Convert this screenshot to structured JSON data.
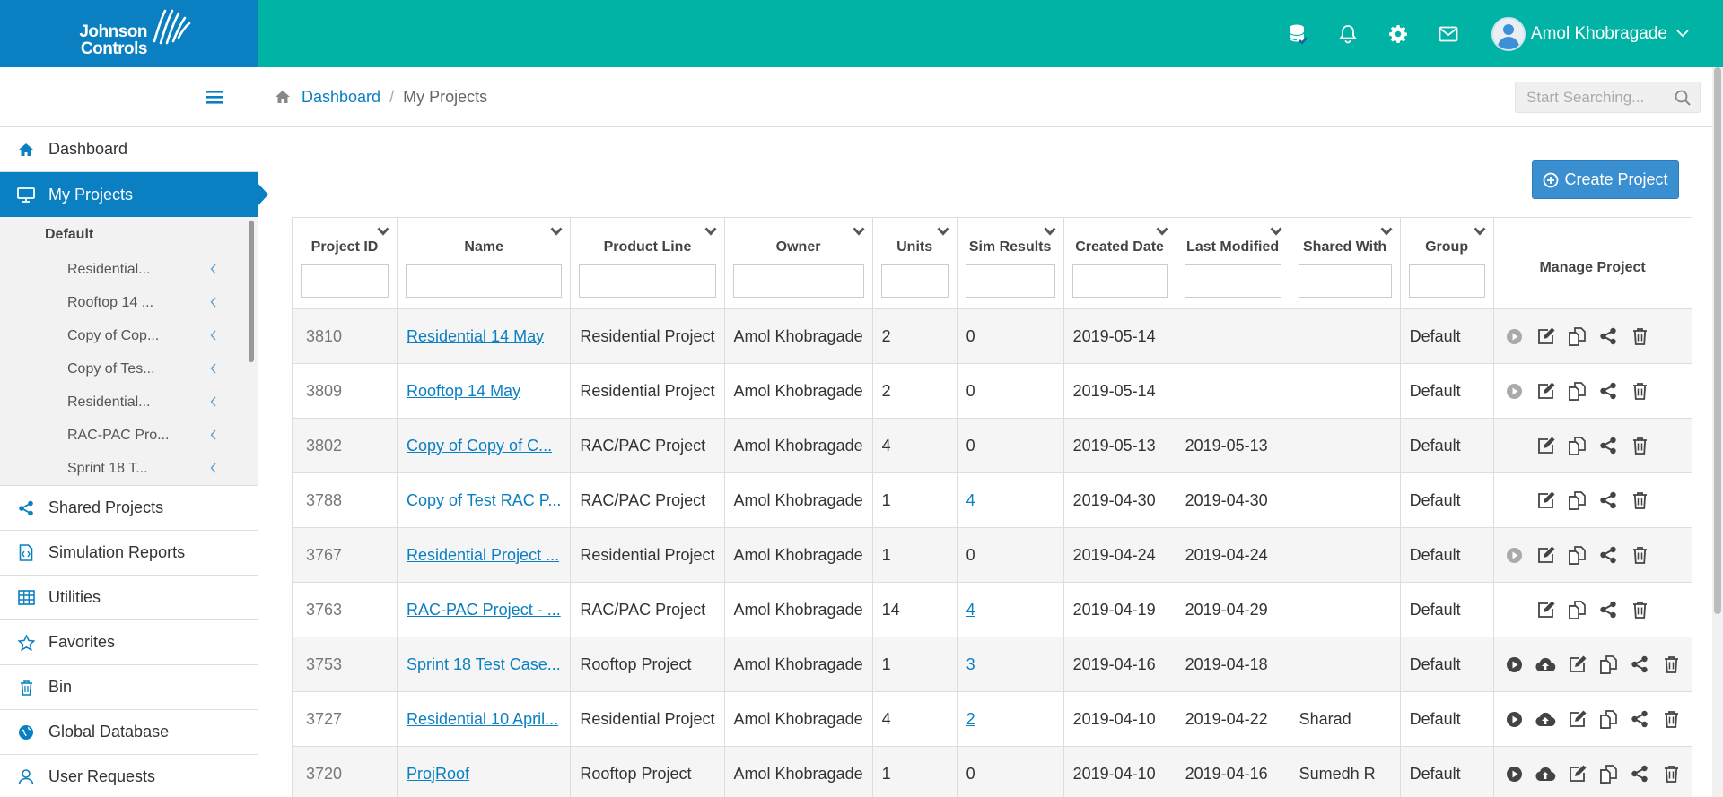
{
  "brand": {
    "line1": "Johnson",
    "line2": "Controls"
  },
  "header": {
    "icons": [
      "database-icon",
      "bell-icon",
      "gear-icon",
      "mail-icon"
    ],
    "user_name": "Amol Khobragade"
  },
  "sidebar": {
    "items": [
      {
        "label": "Dashboard",
        "icon": "home-icon"
      },
      {
        "label": "My Projects",
        "icon": "monitor-icon",
        "active": true
      }
    ],
    "group_label": "Default",
    "sub_items": [
      "Residential...",
      "Rooftop 14 ...",
      "Copy of Cop...",
      "Copy of Tes...",
      "Residential...",
      "RAC-PAC Pro...",
      "Sprint 18 T..."
    ],
    "bottom_items": [
      {
        "label": "Shared Projects",
        "icon": "share-icon"
      },
      {
        "label": "Simulation Reports",
        "icon": "report-icon"
      },
      {
        "label": "Utilities",
        "icon": "grid-icon"
      },
      {
        "label": "Favorites",
        "icon": "star-icon"
      },
      {
        "label": "Bin",
        "icon": "trash-icon"
      },
      {
        "label": "Global Database",
        "icon": "globe-icon"
      },
      {
        "label": "User Requests",
        "icon": "user-icon"
      }
    ]
  },
  "breadcrumb": {
    "home": "Dashboard",
    "sep": "/",
    "current": "My Projects"
  },
  "search": {
    "placeholder": "Start Searching..."
  },
  "create_button": "Create Project",
  "table": {
    "columns": [
      "Project ID",
      "Name",
      "Product Line",
      "Owner",
      "Units",
      "Sim Results",
      "Created Date",
      "Last Modified",
      "Shared With",
      "Group",
      "Manage Project"
    ],
    "rows": [
      {
        "id": "3810",
        "name": "Residential 14 May",
        "product": "Residential Project",
        "owner": "Amol Khobragade",
        "units": "2",
        "sim": "0",
        "sim_link": false,
        "created": "2019-05-14",
        "modified": "",
        "shared": "",
        "group": "Default",
        "actions": [
          "play-muted",
          "edit",
          "copy",
          "share",
          "delete"
        ]
      },
      {
        "id": "3809",
        "name": "Rooftop 14 May",
        "product": "Residential Project",
        "owner": "Amol Khobragade",
        "units": "2",
        "sim": "0",
        "sim_link": false,
        "created": "2019-05-14",
        "modified": "",
        "shared": "",
        "group": "Default",
        "actions": [
          "play-muted",
          "edit",
          "copy",
          "share",
          "delete"
        ]
      },
      {
        "id": "3802",
        "name": "Copy of Copy of C...",
        "product": "RAC/PAC Project",
        "owner": "Amol Khobragade",
        "units": "4",
        "sim": "0",
        "sim_link": false,
        "created": "2019-05-13",
        "modified": "2019-05-13",
        "shared": "",
        "group": "Default",
        "actions": [
          "blank",
          "edit",
          "copy",
          "share",
          "delete"
        ]
      },
      {
        "id": "3788",
        "name": "Copy of Test RAC P...",
        "product": "RAC/PAC Project",
        "owner": "Amol Khobragade",
        "units": "1",
        "sim": "4",
        "sim_link": true,
        "created": "2019-04-30",
        "modified": "2019-04-30",
        "shared": "",
        "group": "Default",
        "actions": [
          "blank",
          "edit",
          "copy",
          "share",
          "delete"
        ]
      },
      {
        "id": "3767",
        "name": "Residential Project ...",
        "product": "Residential Project",
        "owner": "Amol Khobragade",
        "units": "1",
        "sim": "0",
        "sim_link": false,
        "created": "2019-04-24",
        "modified": "2019-04-24",
        "shared": "",
        "group": "Default",
        "actions": [
          "play-muted",
          "edit",
          "copy",
          "share",
          "delete"
        ]
      },
      {
        "id": "3763",
        "name": "RAC-PAC Project - ...",
        "product": "RAC/PAC Project",
        "owner": "Amol Khobragade",
        "units": "14",
        "sim": "4",
        "sim_link": true,
        "created": "2019-04-19",
        "modified": "2019-04-29",
        "shared": "",
        "group": "Default",
        "actions": [
          "blank",
          "edit",
          "copy",
          "share",
          "delete"
        ]
      },
      {
        "id": "3753",
        "name": "Sprint 18 Test Case...",
        "product": "Rooftop Project",
        "owner": "Amol Khobragade",
        "units": "1",
        "sim": "3",
        "sim_link": true,
        "created": "2019-04-16",
        "modified": "2019-04-18",
        "shared": "",
        "group": "Default",
        "actions": [
          "play",
          "upload",
          "edit",
          "copy",
          "share",
          "delete"
        ]
      },
      {
        "id": "3727",
        "name": "Residential 10 April...",
        "product": "Residential Project",
        "owner": "Amol Khobragade",
        "units": "4",
        "sim": "2",
        "sim_link": true,
        "created": "2019-04-10",
        "modified": "2019-04-22",
        "shared": "Sharad",
        "group": "Default",
        "actions": [
          "play",
          "upload",
          "edit",
          "copy",
          "share",
          "delete"
        ]
      },
      {
        "id": "3720",
        "name": "ProjRoof",
        "product": "Rooftop Project",
        "owner": "Amol Khobragade",
        "units": "1",
        "sim": "0",
        "sim_link": false,
        "created": "2019-04-10",
        "modified": "2019-04-16",
        "shared": "Sumedh R",
        "group": "Default",
        "actions": [
          "play",
          "upload",
          "edit",
          "copy",
          "share",
          "delete"
        ]
      }
    ]
  },
  "colors": {
    "brand_blue": "#0a7fc1",
    "header_teal": "#00b3a4",
    "button_blue": "#3a8fd0"
  }
}
